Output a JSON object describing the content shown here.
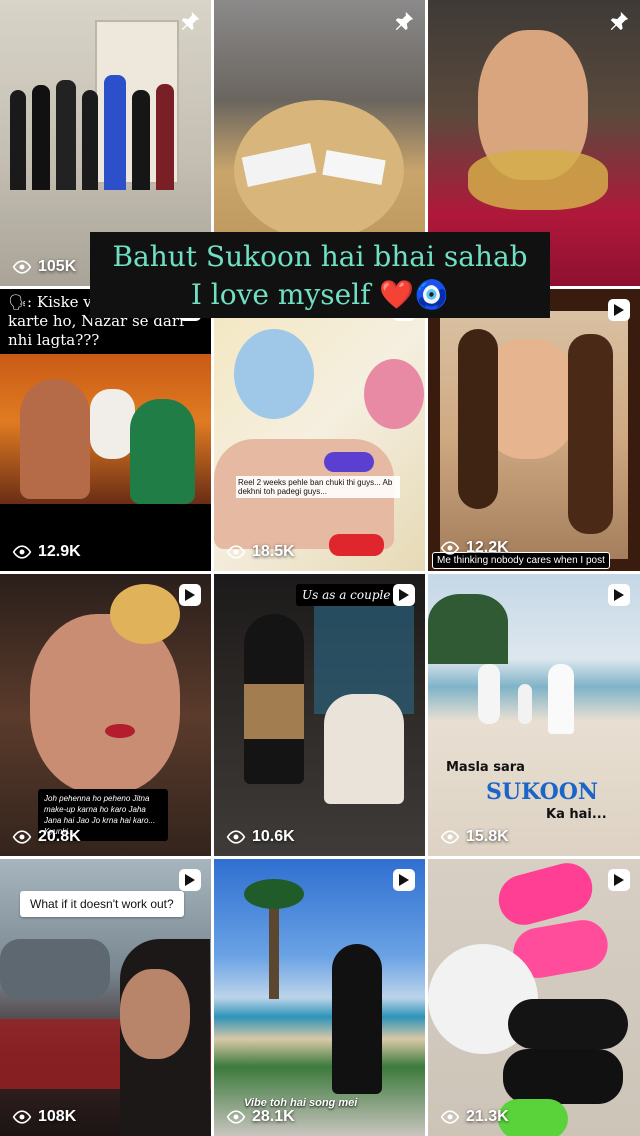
{
  "overlay": {
    "line1": "Bahut Sukoon hai bhai sahab",
    "line2": "I love myself ❤️🧿"
  },
  "tiles": [
    {
      "views": "105K",
      "pinned": true,
      "caption": ""
    },
    {
      "views": "",
      "pinned": true,
      "caption": ""
    },
    {
      "views": "",
      "pinned": true,
      "caption": ""
    },
    {
      "views": "12.9K",
      "pinned": false,
      "caption": "🗣: Kiske videos post karte ho, Nazar se darr nhi lagta???"
    },
    {
      "views": "18.5K",
      "pinned": false,
      "caption": "Reel 2 weeks pehle ban chuki thi guys... Ab dekhni toh padegi guys..."
    },
    {
      "views": "12.2K",
      "pinned": false,
      "caption": "Me thinking nobody cares when I post"
    },
    {
      "views": "20.8K",
      "pinned": false,
      "caption": "Joh pehenna ho peheno Jitna make-up karna ho karo Jaha Jana hai Jao Jo krna hai karo... Kyunki..."
    },
    {
      "views": "10.6K",
      "pinned": false,
      "caption": "Us as a couple 🤍"
    },
    {
      "views": "15.8K",
      "pinned": false,
      "caption_parts": [
        "Masla sara",
        "SUKOON",
        "Ka hai..."
      ]
    },
    {
      "views": "108K",
      "pinned": false,
      "caption": "What if it doesn't work out?"
    },
    {
      "views": "28.1K",
      "pinned": false,
      "caption": "Vibe toh hai song mei"
    },
    {
      "views": "21.3K",
      "pinned": false,
      "caption": ""
    }
  ],
  "icons": {
    "views": "eye-icon",
    "pin": "pin-icon",
    "play": "play-icon"
  }
}
